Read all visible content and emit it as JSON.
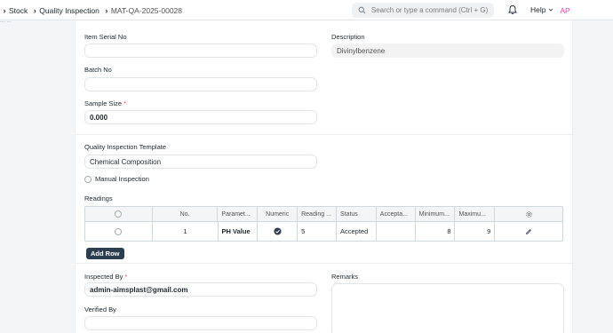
{
  "navbar": {
    "breadcrumbs": [
      "Stock",
      "Quality Inspection",
      "MAT-QA-2025-00028"
    ],
    "search_placeholder": "Search or type a command (Ctrl + G)",
    "help_label": "Help",
    "avatar_initials": "AP",
    "sub_breadcrumb": "... ..."
  },
  "form": {
    "item_serial_no": {
      "label": "Item Serial No",
      "value": ""
    },
    "description": {
      "label": "Description",
      "value": "Divinylbenzene"
    },
    "batch_no": {
      "label": "Batch No",
      "value": ""
    },
    "sample_size": {
      "label": "Sample Size",
      "required": "*",
      "value": "0.000"
    },
    "template": {
      "label": "Quality Inspection Template",
      "value": "Chemical Composition"
    },
    "manual_inspection": {
      "label": "Manual Inspection",
      "checked": false
    },
    "readings": {
      "label": "Readings",
      "columns": [
        "",
        "No.",
        "Paramet...",
        "Numeric",
        "Reading ...",
        "Status",
        "Accepta...",
        "Minimum...",
        "Maximu...",
        ""
      ],
      "rows": [
        {
          "no": "1",
          "parameter": "PH Value",
          "numeric": true,
          "reading": "5",
          "status": "Accepted",
          "acceptance": "",
          "min": "8",
          "max": "9"
        }
      ],
      "add_row_label": "Add Row"
    },
    "inspected_by": {
      "label": "Inspected By",
      "required": "*",
      "value": "admin-aimsplast@gmail.com"
    },
    "verified_by": {
      "label": "Verified By",
      "value": ""
    },
    "remarks": {
      "label": "Remarks",
      "value": ""
    }
  },
  "colors": {
    "accent_dark": "#2c3e50",
    "avatar_pink": "#e64ba2",
    "required_red": "#e24c4c"
  }
}
